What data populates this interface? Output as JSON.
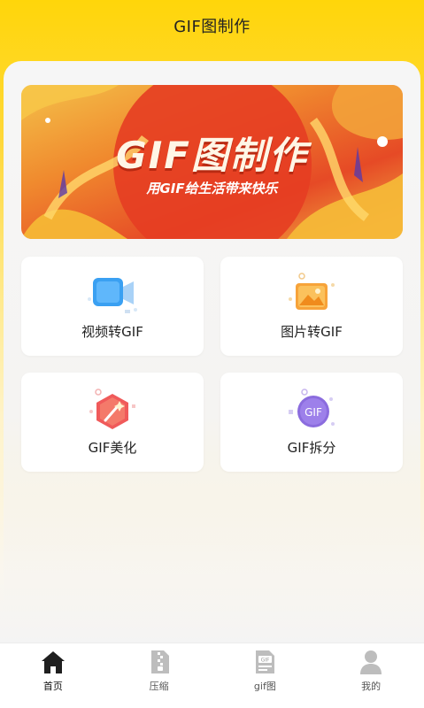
{
  "header": {
    "title": "GIF图制作"
  },
  "banner": {
    "title": "GIF图制作",
    "subtitle": "用GIF给生活带来快乐"
  },
  "features": [
    {
      "label": "视频转GIF",
      "icon": "video-icon"
    },
    {
      "label": "图片转GIF",
      "icon": "image-icon"
    },
    {
      "label": "GIF美化",
      "icon": "magic-wand-icon"
    },
    {
      "label": "GIF拆分",
      "icon": "gif-split-icon",
      "badge": "GIF"
    }
  ],
  "tabbar": {
    "items": [
      {
        "label": "首页",
        "icon": "home-icon",
        "active": true
      },
      {
        "label": "压缩",
        "icon": "zip-file-icon",
        "active": false
      },
      {
        "label": "gif图",
        "icon": "gif-file-icon",
        "badge": "GIF",
        "active": false
      },
      {
        "label": "我的",
        "icon": "user-icon",
        "active": false
      }
    ]
  },
  "colors": {
    "accent": "#ffd60a",
    "banner_red": "#e64a26",
    "text": "#222222"
  }
}
